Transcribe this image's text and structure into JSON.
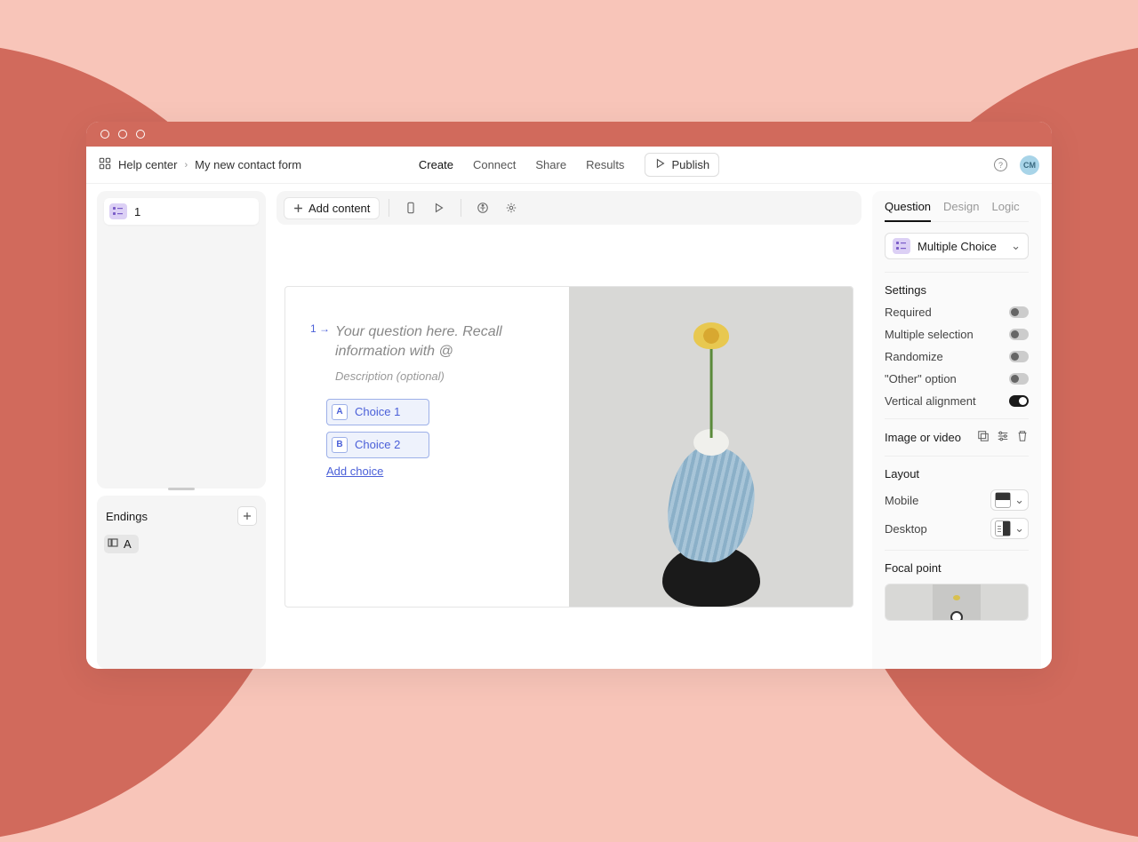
{
  "breadcrumb": {
    "workspace": "Help center",
    "form_name": "My new contact form"
  },
  "top_nav": {
    "create": "Create",
    "connect": "Connect",
    "share": "Share",
    "results": "Results",
    "active": "Create"
  },
  "publish": {
    "label": "Publish"
  },
  "avatar": {
    "initials": "CM"
  },
  "sidebar": {
    "questions": [
      {
        "number": "1",
        "type": "multiple_choice"
      }
    ],
    "endings": {
      "title": "Endings",
      "items": [
        {
          "label": "A"
        }
      ]
    }
  },
  "canvas_toolbar": {
    "add_content": "Add content"
  },
  "form": {
    "question_number": "1",
    "question_placeholder": "Your question here. Recall information with @",
    "description_placeholder": "Description (optional)",
    "choices": [
      {
        "key": "A",
        "label": "Choice 1"
      },
      {
        "key": "B",
        "label": "Choice 2"
      }
    ],
    "add_choice": "Add choice"
  },
  "right_panel": {
    "tabs": {
      "question": "Question",
      "design": "Design",
      "logic": "Logic",
      "active": "Question"
    },
    "type": {
      "label": "Multiple Choice"
    },
    "settings": {
      "title": "Settings",
      "items": [
        {
          "id": "required",
          "label": "Required",
          "on": false
        },
        {
          "id": "multiple_selection",
          "label": "Multiple selection",
          "on": false
        },
        {
          "id": "randomize",
          "label": "Randomize",
          "on": false
        },
        {
          "id": "other_option",
          "label": "\"Other\" option",
          "on": false
        },
        {
          "id": "vertical_alignment",
          "label": "Vertical alignment",
          "on": true
        }
      ]
    },
    "image": {
      "title": "Image or video"
    },
    "layout": {
      "title": "Layout",
      "mobile": "Mobile",
      "desktop": "Desktop"
    },
    "focal": {
      "title": "Focal point"
    }
  }
}
